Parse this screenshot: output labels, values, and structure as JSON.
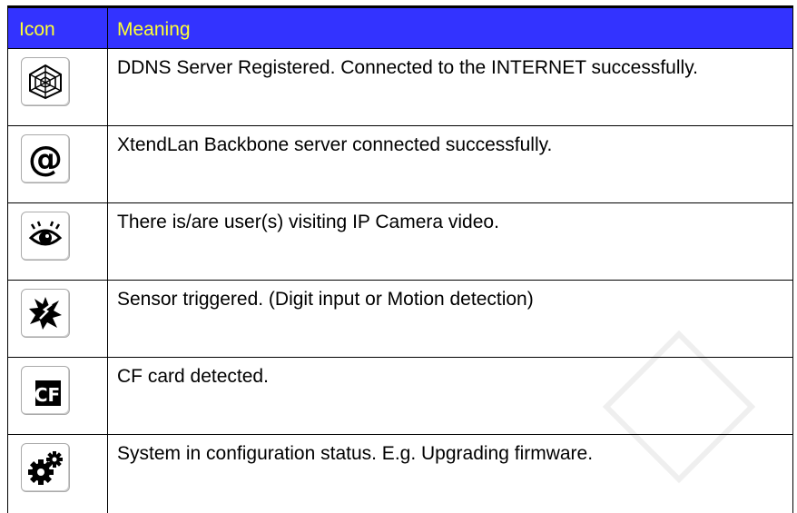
{
  "table": {
    "header": {
      "icon": "Icon",
      "meaning": "Meaning"
    },
    "rows": [
      {
        "icon": "ddns-web-icon",
        "meaning": "DDNS Server Registered. Connected to the INTERNET successfully."
      },
      {
        "icon": "at-sign-icon",
        "meaning": "XtendLan Backbone server connected successfully."
      },
      {
        "icon": "eye-icon",
        "meaning": "There is/are user(s) visiting IP Camera video."
      },
      {
        "icon": "sensor-triggered-icon",
        "meaning": "Sensor triggered. (Digit input or Motion detection)"
      },
      {
        "icon": "cf-card-icon",
        "meaning": "CF card detected."
      },
      {
        "icon": "gears-icon",
        "meaning": "System in configuration status. E.g. Upgrading firmware."
      }
    ]
  },
  "colors": {
    "header_bg": "#3333ff",
    "header_text": "#ffff33"
  }
}
